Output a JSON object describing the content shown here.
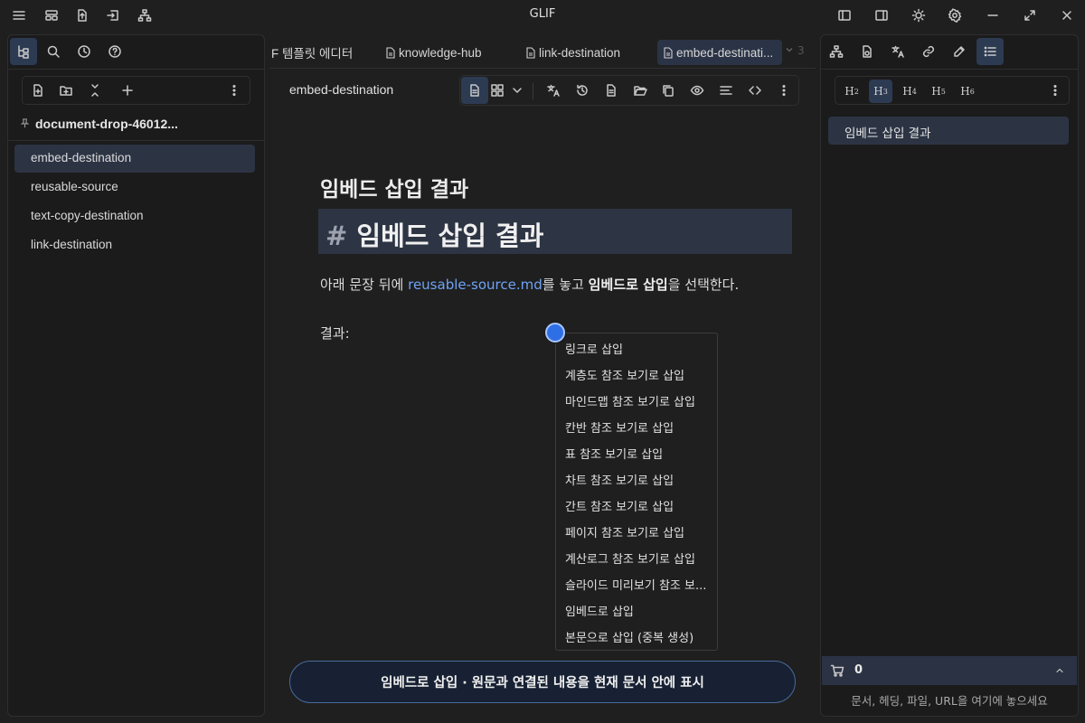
{
  "app": {
    "title": "GLIF"
  },
  "sidebar": {
    "vault_name": "document-drop-46012...",
    "files": [
      {
        "label": "embed-destination",
        "selected": true
      },
      {
        "label": "reusable-source",
        "selected": false
      },
      {
        "label": "text-copy-destination",
        "selected": false
      },
      {
        "label": "link-destination",
        "selected": false
      }
    ]
  },
  "tabs": [
    {
      "label": "F 템플릿 에디터"
    },
    {
      "label": "knowledge-hub"
    },
    {
      "label": "link-destination"
    },
    {
      "label": "embed-destinati..."
    }
  ],
  "tab_overflow": {
    "count": "3"
  },
  "document": {
    "header_title": "embed-destination",
    "heading": "임베드 삽입 결과",
    "source_hash": "#",
    "source_text": "임베드 삽입 결과",
    "para_before": "아래 문장 뒤에 ",
    "para_link": "reusable-source.md",
    "para_mid": "를 놓고 ",
    "para_bold": "임베드로 삽입",
    "para_after": "을 선택한다.",
    "result_label": "결과:"
  },
  "context_menu": {
    "items": [
      "링크로 삽입",
      "계층도 참조 보기로 삽입",
      "마인드맵 참조 보기로 삽입",
      "칸반 참조 보기로 삽입",
      "표 참조 보기로 삽입",
      "차트 참조 보기로 삽입",
      "간트 참조 보기로 삽입",
      "페이지 참조 보기로 삽입",
      "계산로그 참조 보기로 삽입",
      "슬라이드 미리보기 참조 보...",
      "임베드로 삽입",
      "본문으로 삽입 (중복 생성)"
    ]
  },
  "banner": {
    "text": "임베드로 삽입 · 원문과 연결된 내용을 현재 문서 안에 표시"
  },
  "right_panel": {
    "heading_levels": [
      "H2",
      "H3",
      "H4",
      "H5",
      "H6"
    ],
    "active_level": "H3",
    "outline_item": "임베드 삽입 결과",
    "cart_count": "0",
    "drop_hint": "문서, 헤딩, 파일, URL을 여기에 놓으세요"
  },
  "colors": {
    "accent": "#2f6fe6",
    "link": "#6fa3f5",
    "selection": "#2c3444"
  }
}
